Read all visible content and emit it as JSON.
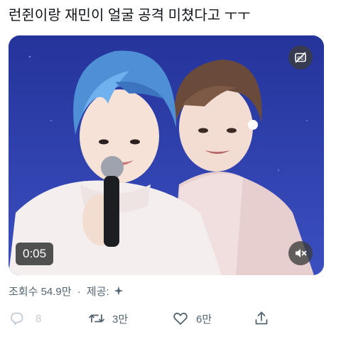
{
  "tweet": {
    "text": "런쥔이랑 재민이 얼굴 공격 미쳤다고 ㅜㅜ"
  },
  "video": {
    "timestamp": "0:05",
    "captions_icon": "cc-off-icon",
    "sound_icon": "mute-icon"
  },
  "meta": {
    "views_label": "조회수 54.9만",
    "separator": "·",
    "provider_label": "제공:",
    "provider_icon": "sparkle-icon"
  },
  "actions": {
    "reply_count": "8",
    "retweet_count": "3만",
    "like_count": "6만"
  }
}
